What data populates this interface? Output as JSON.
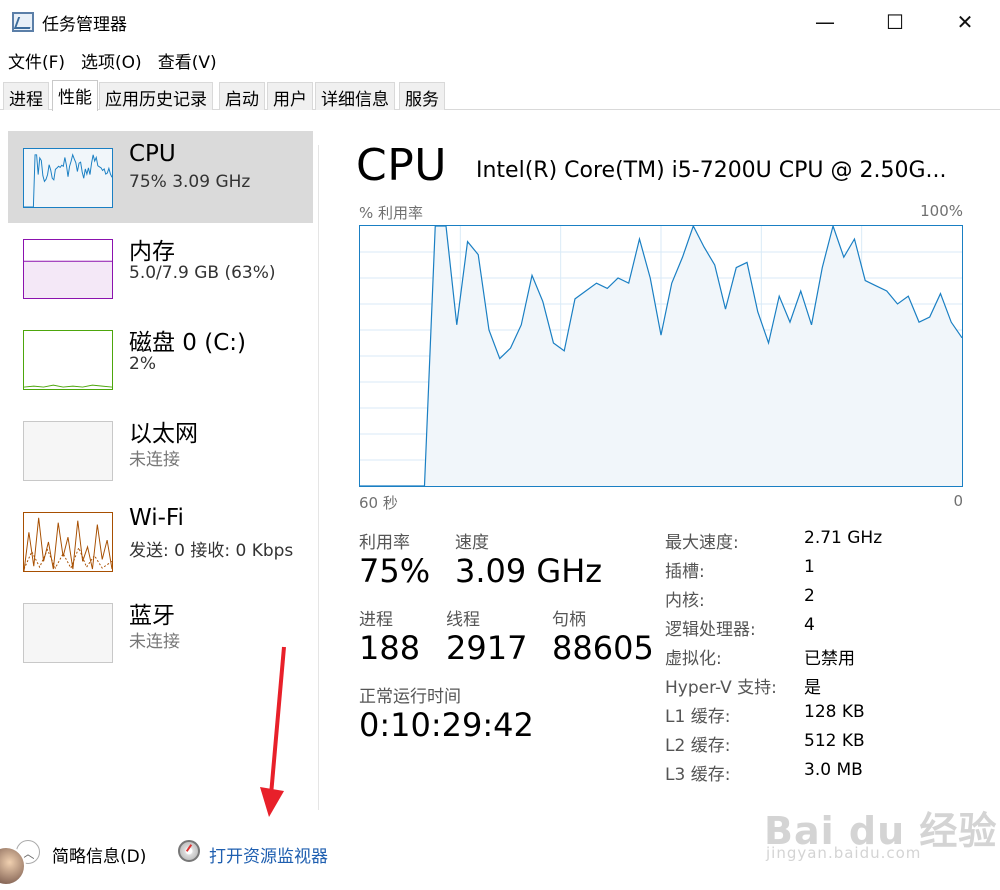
{
  "window": {
    "title": "任务管理器",
    "minimize": "—",
    "maximize": "☐",
    "close": "✕"
  },
  "menu": [
    "文件(F)",
    "选项(O)",
    "查看(V)"
  ],
  "tabs": [
    "进程",
    "性能",
    "应用历史记录",
    "启动",
    "用户",
    "详细信息",
    "服务"
  ],
  "active_tab": 1,
  "sidebar": [
    {
      "name": "CPU",
      "sub": "75%  3.09 GHz",
      "color": "#1a7fc3"
    },
    {
      "name": "内存",
      "sub": "5.0/7.9 GB (63%)",
      "color": "#8b12ae"
    },
    {
      "name": "磁盘 0 (C:)",
      "sub": "2%",
      "color": "#4da60c"
    },
    {
      "name": "以太网",
      "sub": "未连接",
      "color": "#a0a0a0"
    },
    {
      "name": "Wi-Fi",
      "sub": "发送: 0  接收: 0 Kbps",
      "color": "#a74f01"
    },
    {
      "name": "蓝牙",
      "sub": "未连接",
      "color": "#a0a0a0"
    }
  ],
  "main": {
    "title": "CPU",
    "model": "Intel(R) Core(TM) i5-7200U CPU @ 2.50G...",
    "graph_label_left": "% 利用率",
    "graph_label_right": "100%",
    "axis_left": "60 秒",
    "axis_right": "0",
    "utilization_label": "利用率",
    "utilization_value": "75%",
    "speed_label": "速度",
    "speed_value": "3.09 GHz",
    "processes_label": "进程",
    "processes_value": "188",
    "threads_label": "线程",
    "threads_value": "2917",
    "handles_label": "句柄",
    "handles_value": "88605",
    "uptime_label": "正常运行时间",
    "uptime_value": "0:10:29:42",
    "specs": [
      {
        "label": "最大速度:",
        "value": "2.71 GHz"
      },
      {
        "label": "插槽:",
        "value": "1"
      },
      {
        "label": "内核:",
        "value": "2"
      },
      {
        "label": "逻辑处理器:",
        "value": "4"
      },
      {
        "label": "虚拟化:",
        "value": "已禁用"
      },
      {
        "label": "Hyper-V 支持:",
        "value": "是"
      },
      {
        "label": "L1 缓存:",
        "value": "128 KB"
      },
      {
        "label": "L2 缓存:",
        "value": "512 KB"
      },
      {
        "label": "L3 缓存:",
        "value": "3.0 MB"
      }
    ],
    "cpu_history": [
      0,
      0,
      0,
      0,
      0,
      0,
      0,
      100,
      100,
      62,
      94,
      89,
      60,
      49,
      53,
      62,
      81,
      71,
      55,
      52,
      72,
      75,
      78,
      76,
      80,
      78,
      95,
      80,
      58,
      78,
      88,
      100,
      92,
      85,
      68,
      84,
      86,
      67,
      55,
      73,
      63,
      75,
      62,
      84,
      100,
      88,
      95,
      79,
      77,
      75,
      70,
      73,
      63,
      65,
      74,
      63,
      57
    ]
  },
  "footer": {
    "brief_label": "简略信息(D)",
    "monitor_link": "打开资源监视器"
  },
  "watermark": {
    "logo": "Bai du 经验",
    "sub": "jingyan.baidu.com"
  },
  "colors": {
    "cpu_line": "#1a7fc3",
    "cpu_fill": "#f1f6fa",
    "grid": "#d9eaf7",
    "link": "#1f5fb0",
    "arrow": "#e8202a"
  }
}
